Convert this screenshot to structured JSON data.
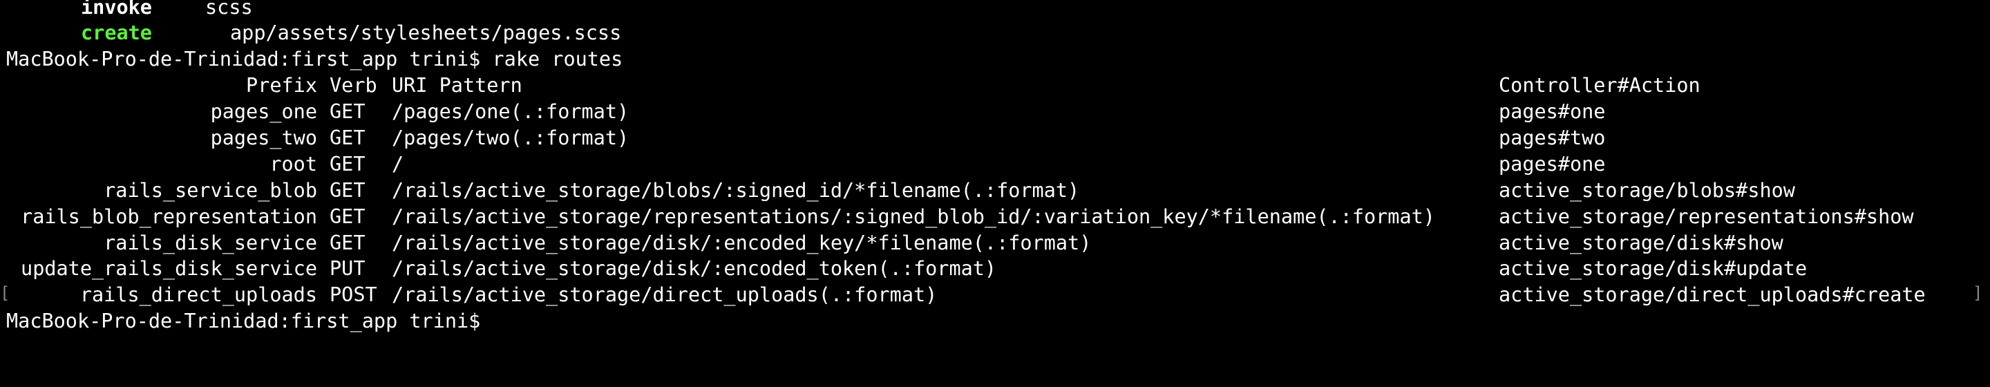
{
  "terminal": {
    "colors": {
      "background": "#000000",
      "text": "#ffffff",
      "create_green": "#5af03c"
    },
    "generate_lines": [
      {
        "action": "invoke",
        "target": "scss",
        "color": "#ffffff"
      },
      {
        "action": "create",
        "target": "app/assets/stylesheets/pages.scss",
        "color": "#5af03c"
      }
    ],
    "prompt_1": "MacBook-Pro-de-Trinidad:first_app trini$ rake routes",
    "routes_header": {
      "prefix": "Prefix",
      "verb": "Verb",
      "uri": "URI Pattern",
      "controller": "Controller#Action"
    },
    "routes": [
      {
        "prefix": "pages_one",
        "verb": "GET",
        "uri": "/pages/one(.:format)",
        "action": "pages#one"
      },
      {
        "prefix": "pages_two",
        "verb": "GET",
        "uri": "/pages/two(.:format)",
        "action": "pages#two"
      },
      {
        "prefix": "root",
        "verb": "GET",
        "uri": "/",
        "action": "pages#one"
      },
      {
        "prefix": "rails_service_blob",
        "verb": "GET",
        "uri": "/rails/active_storage/blobs/:signed_id/*filename(.:format)",
        "action": "active_storage/blobs#show"
      },
      {
        "prefix": "rails_blob_representation",
        "verb": "GET",
        "uri": "/rails/active_storage/representations/:signed_blob_id/:variation_key/*filename(.:format)",
        "action": "active_storage/representations#show"
      },
      {
        "prefix": "rails_disk_service",
        "verb": "GET",
        "uri": "/rails/active_storage/disk/:encoded_key/*filename(.:format)",
        "action": "active_storage/disk#show"
      },
      {
        "prefix": "update_rails_disk_service",
        "verb": "PUT",
        "uri": "/rails/active_storage/disk/:encoded_token(.:format)",
        "action": "active_storage/disk#update"
      },
      {
        "prefix": "rails_direct_uploads",
        "verb": "POST",
        "uri": "/rails/active_storage/direct_uploads(.:format)",
        "action": "active_storage/direct_uploads#create"
      }
    ],
    "prompt_2": "MacBook-Pro-de-Trinidad:first_app trini$"
  }
}
